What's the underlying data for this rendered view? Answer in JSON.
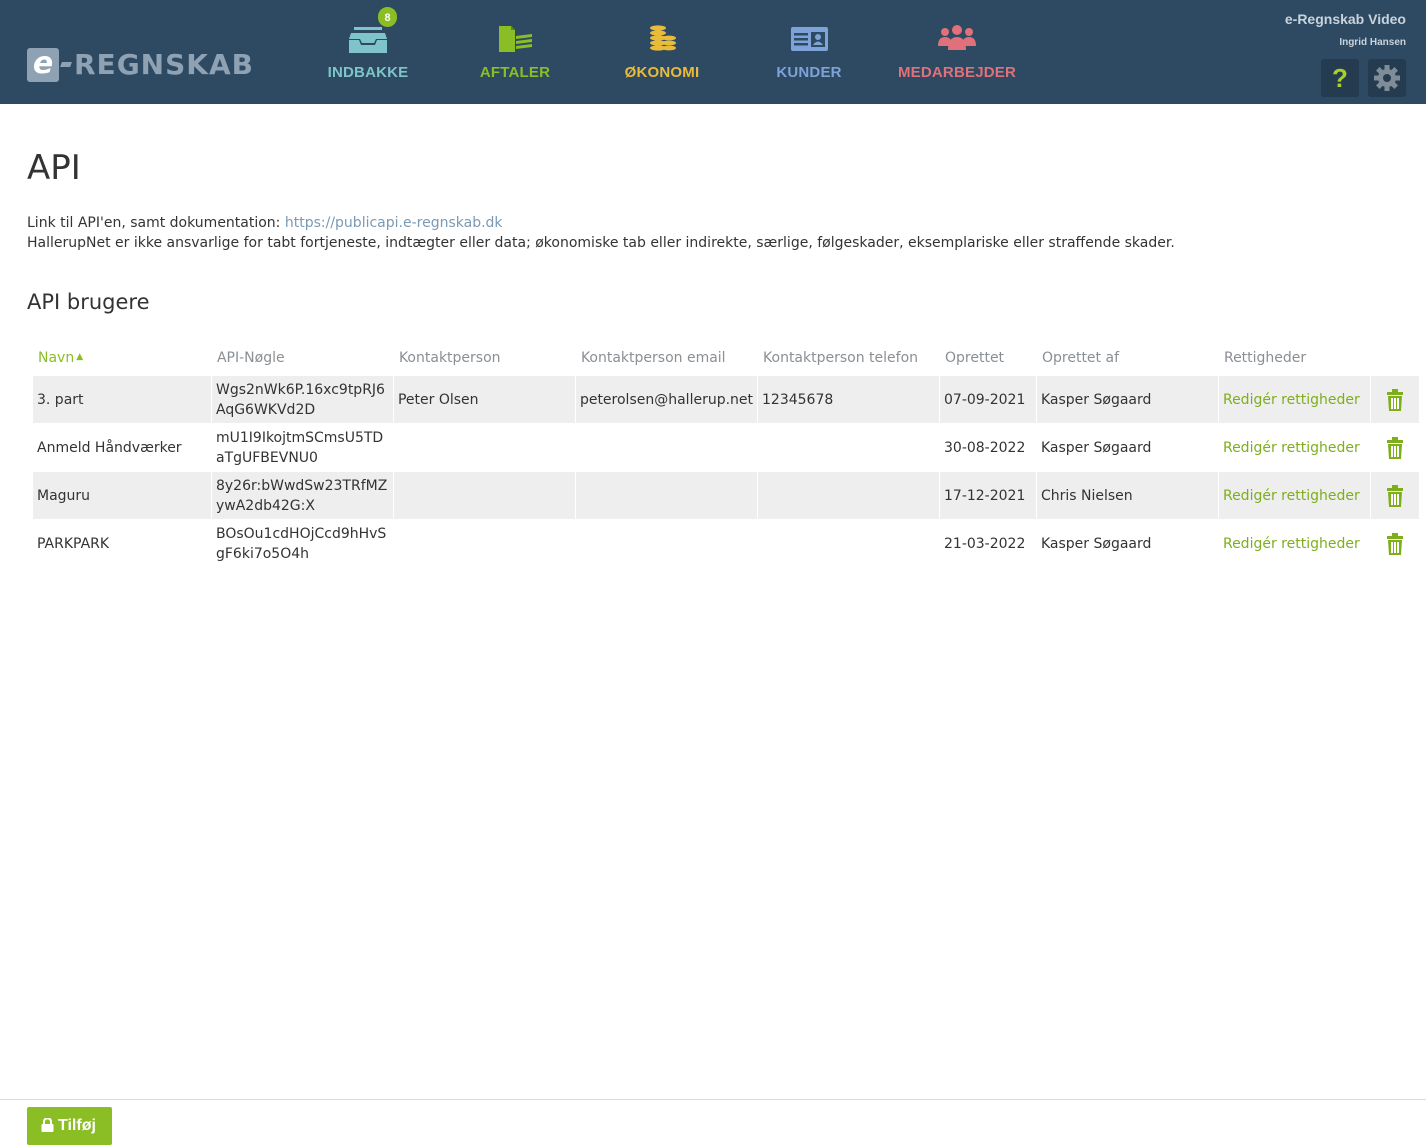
{
  "header": {
    "logo_text": "REGNSKAB",
    "logo_letter": "e",
    "nav": [
      {
        "label": "INDBAKKE",
        "icon": "inbox-icon",
        "color": "#7ec4c9",
        "badge": "8"
      },
      {
        "label": "AFTALER",
        "icon": "documents-icon",
        "color": "#8bbd24"
      },
      {
        "label": "ØKONOMI",
        "icon": "coins-icon",
        "color": "#e8bb3a"
      },
      {
        "label": "KUNDER",
        "icon": "id-card-icon",
        "color": "#7fa2d9"
      },
      {
        "label": "MEDARBEJDER",
        "icon": "people-icon",
        "color": "#e0707a"
      }
    ],
    "account_title": "e-Regnskab Video",
    "account_user": "Ingrid Hansen",
    "help_label": "?"
  },
  "page": {
    "title": "API",
    "link_prefix": "Link til API'en, samt dokumentation:",
    "link_text": "https://publicapi.e-regnskab.dk",
    "disclaimer": "HallerupNet er ikke ansvarlige for tabt fortjeneste, indtægter eller data; økonomiske tab eller indirekte, særlige, følgeskader, eksemplariske eller straffende skader.",
    "section_title": "API brugere"
  },
  "table": {
    "columns": [
      "Navn",
      "API-Nøgle",
      "Kontaktperson",
      "Kontaktperson email",
      "Kontaktperson telefon",
      "Oprettet",
      "Oprettet af",
      "Rettigheder"
    ],
    "sort_indicator": "▲",
    "rows": [
      {
        "name": "3. part",
        "key": "Wgs2nWk6P.16xc9tpRJ6AqG6WKVd2D",
        "contact": "Peter Olsen",
        "email": "peterolsen@hallerup.net",
        "phone": "12345678",
        "created": "07-09-2021",
        "created_by": "Kasper Søgaard",
        "rights": "Redigér rettigheder"
      },
      {
        "name": "Anmeld Håndværker",
        "key": "mU1I9IkojtmSCmsU5TDaTgUFBEVNU0",
        "contact": "",
        "email": "",
        "phone": "",
        "created": "30-08-2022",
        "created_by": "Kasper Søgaard",
        "rights": "Redigér rettigheder"
      },
      {
        "name": "Maguru",
        "key": "8y26r:bWwdSw23TRfMZywA2db42G:X",
        "contact": "",
        "email": "",
        "phone": "",
        "created": "17-12-2021",
        "created_by": "Chris Nielsen",
        "rights": "Redigér rettigheder"
      },
      {
        "name": "PARKPARK",
        "key": "BOsOu1cdHOjCcd9hHvSgF6ki7o5O4h",
        "contact": "",
        "email": "",
        "phone": "",
        "created": "21-03-2022",
        "created_by": "Kasper Søgaard",
        "rights": "Redigér rettigheder"
      }
    ]
  },
  "footer": {
    "add_label": "Tilføj"
  }
}
